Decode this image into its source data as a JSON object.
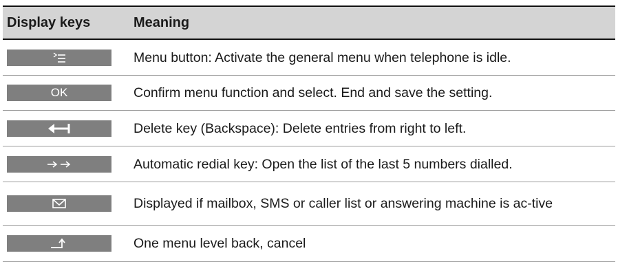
{
  "table": {
    "headers": {
      "keys": "Display keys",
      "meaning": "Meaning"
    },
    "rows": [
      {
        "icon": "menu-icon",
        "meaning": "Menu button: Activate the general menu when telephone is idle."
      },
      {
        "icon": "ok-icon",
        "label": "OK",
        "meaning": "Confirm menu function and select. End and save the setting."
      },
      {
        "icon": "backspace-icon",
        "meaning": "Delete key (Backspace): Delete entries from right to left."
      },
      {
        "icon": "redial-icon",
        "meaning": "Automatic redial key: Open the list of the last 5 numbers dialled."
      },
      {
        "icon": "envelope-icon",
        "meaning": "Displayed if mailbox, SMS or caller list or answering machine is ac-tive"
      },
      {
        "icon": "back-icon",
        "meaning": "One menu level back, cancel"
      }
    ]
  },
  "colors": {
    "header_bg": "#d4d4d4",
    "keycap_bg": "#7f7f7f",
    "keycap_fg": "#ffffff",
    "rule": "#9a9a9a"
  }
}
